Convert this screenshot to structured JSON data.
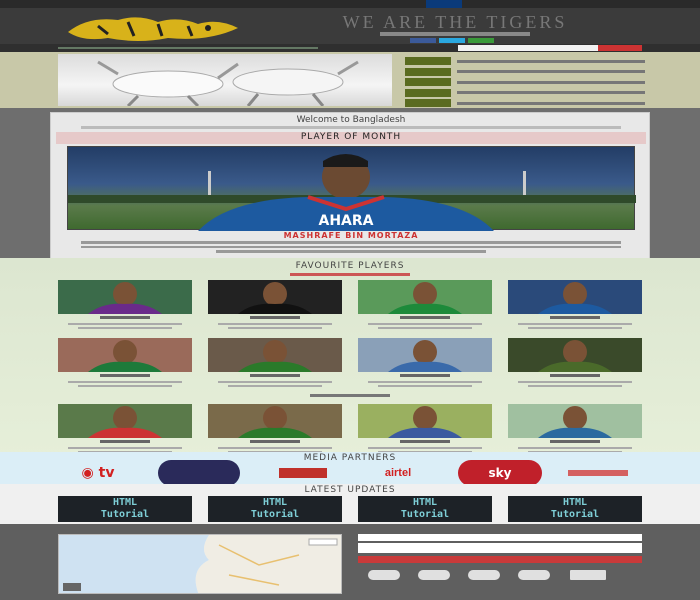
{
  "header": {
    "title": "WE ARE THE TIGERS"
  },
  "welcome": {
    "heading": "Welcome to Bangladesh"
  },
  "player_of_month": {
    "heading": "PLAYER OF MONTH",
    "name": "MASHRAFE BIN MORTAZA",
    "jersey_text": "AHARA"
  },
  "players_section": {
    "heading": "FAVOURITE PLAYERS"
  },
  "media": {
    "heading": "MEDIA PARTNERS",
    "partners": [
      {
        "label": "tv",
        "color": "#d22020"
      },
      {
        "label": "",
        "color": "#2a2a5a"
      },
      {
        "label": "",
        "color": "#c0302a"
      },
      {
        "label": "airtel",
        "color": "#d22020"
      },
      {
        "label": "sky",
        "color": "#c0202a"
      },
      {
        "label": "",
        "color": "#d46060"
      }
    ]
  },
  "updates": {
    "heading": "LATEST UPDATES",
    "cards": [
      {
        "line1": "HTML",
        "line2": "Tutorial"
      },
      {
        "line1": "HTML",
        "line2": "Tutorial"
      },
      {
        "line1": "HTML",
        "line2": "Tutorial"
      },
      {
        "line1": "HTML",
        "line2": "Tutorial"
      }
    ]
  },
  "colors": {
    "accent_red": "#c93a3a",
    "header_bg": "#3b3b3b",
    "nav_active": "#0a3a7a"
  }
}
